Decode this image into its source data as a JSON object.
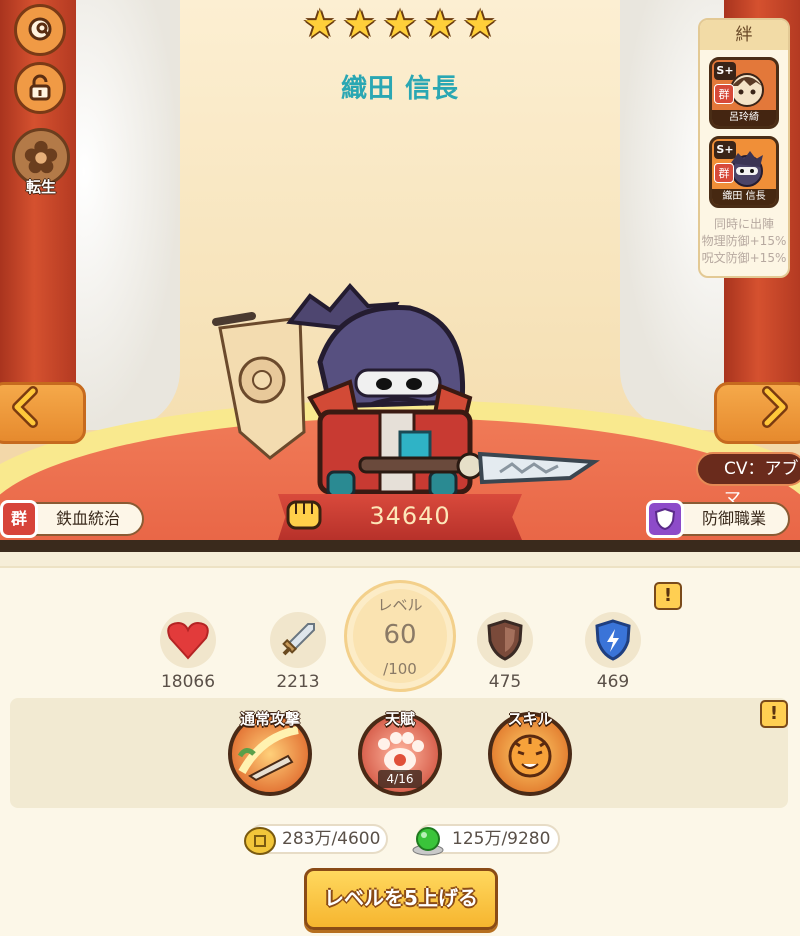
{
  "hero": {
    "stars": [
      "★",
      "★",
      "★",
      "★",
      "★"
    ],
    "name": "織田 信長",
    "power": "34640",
    "cv": "CV：アブマ",
    "faction_tag": {
      "icon": "群",
      "label": "鉄血統治"
    },
    "role_tag": {
      "label": "防御職業"
    }
  },
  "side": {
    "rebirth_label": "転生"
  },
  "bond": {
    "title": "絆",
    "cards": [
      {
        "rank": "S+",
        "faction": "群",
        "name": "呂玲綺"
      },
      {
        "rank": "S+",
        "faction": "群",
        "name": "織田 信長"
      }
    ],
    "desc": [
      "同時に出陣",
      "物理防御+15%",
      "呪文防御+15%"
    ]
  },
  "stats": {
    "hp": "18066",
    "attack": "2213",
    "phys_def": "475",
    "magic_def": "469",
    "level_label": "レベル",
    "level": "60",
    "level_max": "/100",
    "info_mark": "!"
  },
  "skills": [
    {
      "label": "通常攻撃",
      "icon": "sword-slash-icon"
    },
    {
      "label": "天賦",
      "icon": "paw-icon",
      "count": "4/16"
    },
    {
      "label": "スキル",
      "icon": "tiger-icon"
    }
  ],
  "resources": {
    "gold": "283万/4600",
    "exp": "125万/9280"
  },
  "levelup_button": "レベルを5上げる",
  "colors": {
    "name": "#2aa7b3",
    "pillar": "#d5512f",
    "button": "#f6b52f"
  }
}
